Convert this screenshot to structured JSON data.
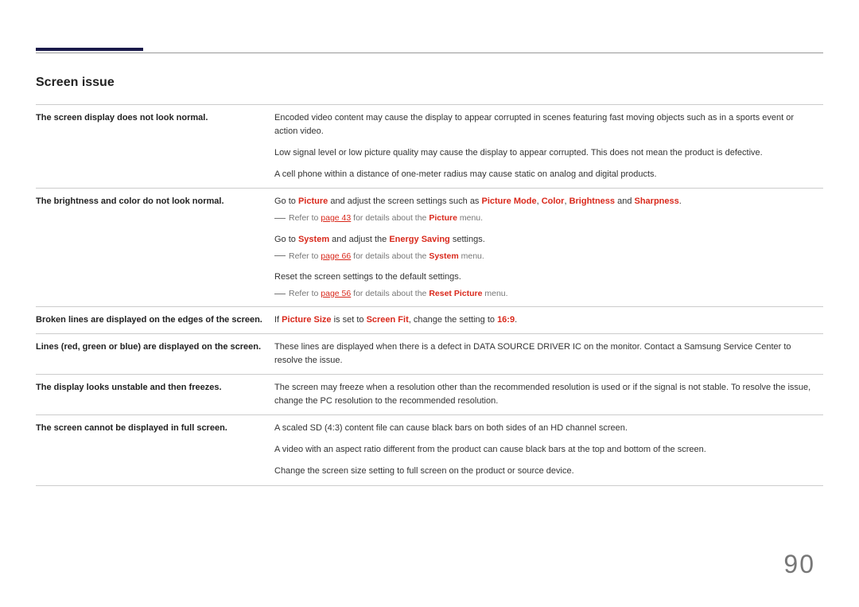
{
  "section_title": "Screen issue",
  "page_number": "90",
  "rows": [
    {
      "label": "The screen display does not look normal.",
      "p1": "Encoded video content may cause the display to appear corrupted in scenes featuring fast moving objects such as in a sports event or action video.",
      "p2": "Low signal level or low picture quality may cause the display to appear corrupted. This does not mean the product is defective.",
      "p3": "A cell phone within a distance of one-meter radius may cause static on analog and digital products."
    },
    {
      "label": "The brightness and color do not look normal.",
      "b1_pre": "Go to ",
      "b1_hl1": "Picture",
      "b1_mid": " and adjust the screen settings such as ",
      "b1_hl2": "Picture Mode",
      "b1_c1": ", ",
      "b1_hl3": "Color",
      "b1_c2": ", ",
      "b1_hl4": "Brightness",
      "b1_and": " and ",
      "b1_hl5": "Sharpness",
      "b1_dot": ".",
      "n1_pre": "Refer to ",
      "n1_link": "page 43",
      "n1_mid": " for details about the ",
      "n1_hl": "Picture",
      "n1_end": " menu.",
      "b2_pre": "Go to ",
      "b2_hl1": "System",
      "b2_mid": " and adjust the ",
      "b2_hl2": "Energy Saving",
      "b2_end": " settings.",
      "n2_pre": "Refer to ",
      "n2_link": "page 66",
      "n2_mid": " for details about the ",
      "n2_hl": "System",
      "n2_end": " menu.",
      "b3": "Reset the screen settings to the default settings.",
      "n3_pre": "Refer to ",
      "n3_link": "page 56",
      "n3_mid": " for details about the ",
      "n3_hl": "Reset Picture",
      "n3_end": " menu."
    },
    {
      "label": "Broken lines are displayed on the edges of the screen.",
      "pre": "If ",
      "hl1": "Picture Size",
      "mid1": " is set to ",
      "hl2": "Screen Fit",
      "mid2": ", change the setting to ",
      "hl3": "16:9",
      "end": "."
    },
    {
      "label": "Lines (red, green or blue) are displayed on the screen.",
      "text": "These lines are displayed when there is a defect in DATA SOURCE DRIVER IC on the monitor. Contact a Samsung Service Center to resolve the issue."
    },
    {
      "label": "The display looks unstable and then freezes.",
      "text": "The screen may freeze when a resolution other than the recommended resolution is used or if the signal is not stable. To resolve the issue, change the PC resolution to the recommended resolution."
    },
    {
      "label": "The screen cannot be displayed in full screen.",
      "p1": "A scaled SD (4:3) content file can cause black bars on both sides of an HD channel screen.",
      "p2": "A video with an aspect ratio different from the product can cause black bars at the top and bottom of the screen.",
      "p3": "Change the screen size setting to full screen on the product or source device."
    }
  ]
}
